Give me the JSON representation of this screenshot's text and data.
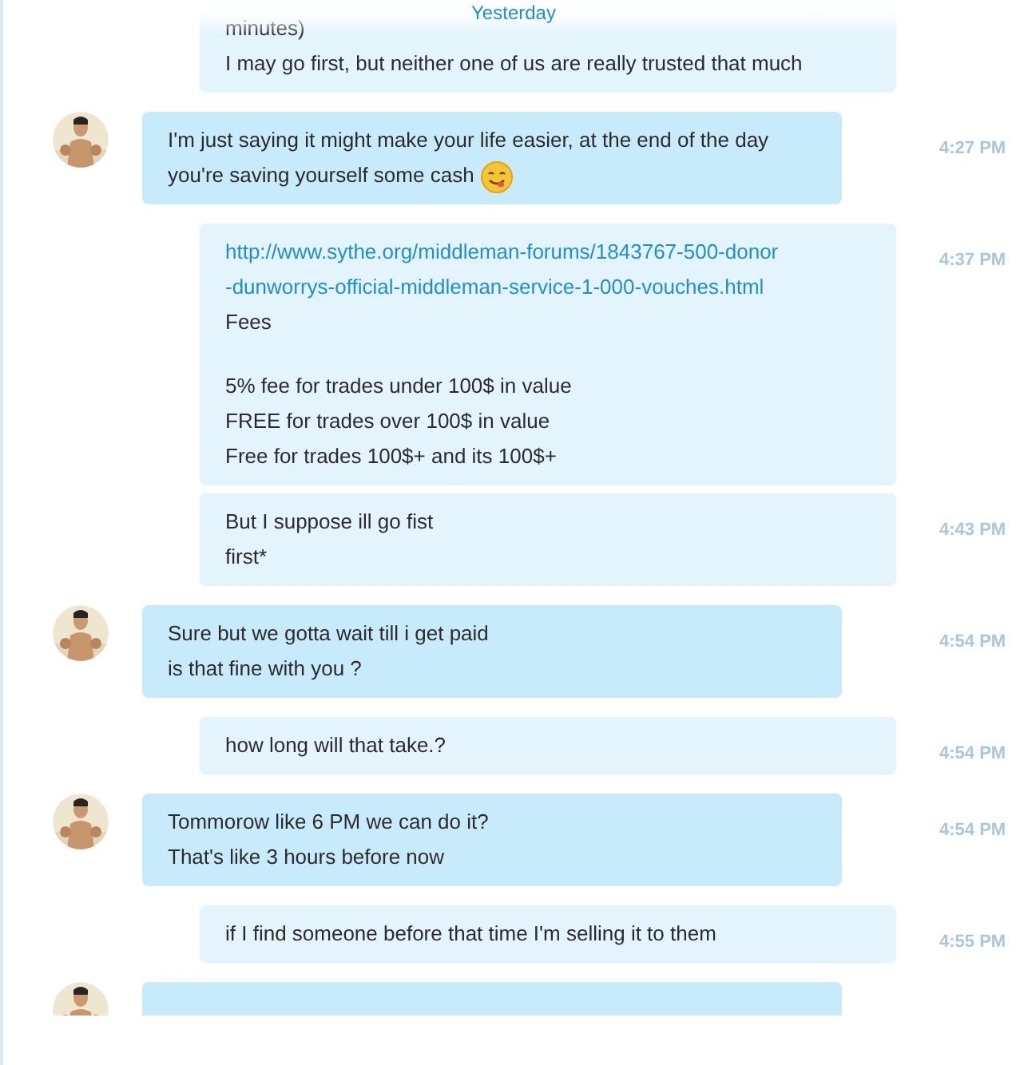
{
  "date_header": "Yesterday",
  "messages": [
    {
      "kind": "outgoing",
      "lines": [
        {
          "kind": "text",
          "text": "minutes)"
        },
        {
          "kind": "text",
          "text": "I may go first, but neither one of us are really trusted that much"
        }
      ]
    },
    {
      "kind": "incoming",
      "time": "4:27 PM",
      "lines": [
        {
          "kind": "text",
          "text": "I'm just saying it might make your life easier, at the end of the day"
        },
        {
          "kind": "text",
          "text": "you're saving yourself some cash",
          "emoji": true
        }
      ]
    },
    {
      "kind": "outgoing",
      "time": "4:37 PM",
      "lines": [
        {
          "kind": "link",
          "text": "http://www.sythe.org/middleman-forums/1843767-500-donor"
        },
        {
          "kind": "link",
          "text": "-dunworrys-official-middleman-service-1-000-vouches.html"
        },
        {
          "kind": "text",
          "text": "Fees"
        },
        {
          "kind": "text",
          "text": "5% fee for trades under 100$ in value",
          "gap_before": true
        },
        {
          "kind": "text",
          "text": "FREE for trades over 100$ in value"
        },
        {
          "kind": "text",
          "text": "Free for trades 100$+ and its 100$+"
        }
      ]
    },
    {
      "kind": "outgoing",
      "time": "4:43 PM",
      "lines": [
        {
          "kind": "text",
          "text": "But I suppose ill go fist"
        },
        {
          "kind": "text",
          "text": "first*"
        }
      ]
    },
    {
      "kind": "incoming",
      "time": "4:54 PM",
      "lines": [
        {
          "kind": "text",
          "text": "Sure but we gotta wait till i get paid"
        },
        {
          "kind": "text",
          "text": "is that fine with you ?"
        }
      ]
    },
    {
      "kind": "outgoing",
      "time": "4:54 PM",
      "lines": [
        {
          "kind": "text",
          "text": "how long will that take.?"
        }
      ]
    },
    {
      "kind": "incoming",
      "time": "4:54 PM",
      "lines": [
        {
          "kind": "text",
          "text": "Tommorow like 6 PM we can do it?"
        },
        {
          "kind": "text",
          "text": "That's like 3 hours before now"
        }
      ]
    },
    {
      "kind": "outgoing",
      "time": "4:55 PM",
      "lines": [
        {
          "kind": "text",
          "text": "if I find someone before that time I'm selling it to them"
        }
      ]
    },
    {
      "kind": "incoming"
    }
  ]
}
